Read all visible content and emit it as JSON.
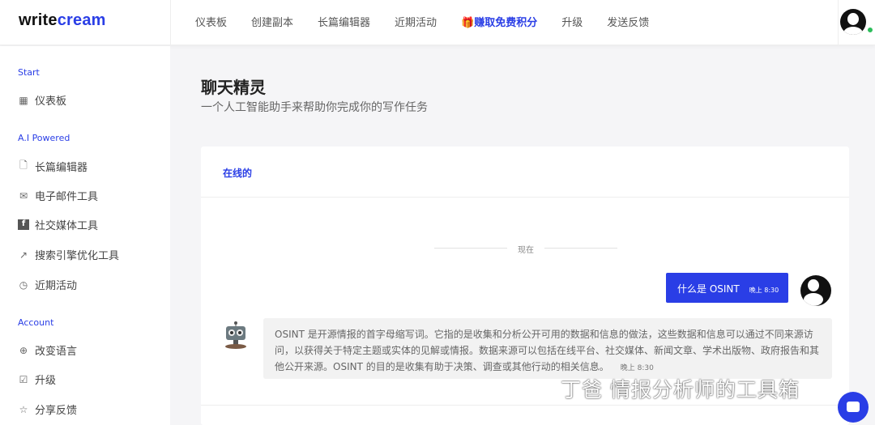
{
  "header": {
    "logo_a": "write",
    "logo_b": "cream",
    "nav": [
      "仪表板",
      "创建副本",
      "长篇编辑器",
      "近期活动",
      "🎁赚取免费积分",
      "升级",
      "发送反馈"
    ]
  },
  "sidebar": {
    "sections": [
      {
        "title": "Start",
        "items": [
          {
            "label": "仪表板",
            "icon": "dashboard-icon"
          }
        ]
      },
      {
        "title": "A.I Powered",
        "items": [
          {
            "label": "长篇编辑器",
            "icon": "document-plus-icon"
          },
          {
            "label": "电子邮件工具",
            "icon": "mail-icon"
          },
          {
            "label": "社交媒体工具",
            "icon": "facebook-icon"
          },
          {
            "label": "搜索引擎优化工具",
            "icon": "trend-icon"
          },
          {
            "label": "近期活动",
            "icon": "clock-icon"
          }
        ]
      },
      {
        "title": "Account",
        "items": [
          {
            "label": "改变语言",
            "icon": "globe-icon"
          },
          {
            "label": "升级",
            "icon": "checkbox-icon"
          },
          {
            "label": "分享反馈",
            "icon": "star-icon"
          }
        ]
      }
    ]
  },
  "main": {
    "title": "聊天精灵",
    "subtitle": "一个人工智能助手来帮助你完成你的写作任务",
    "status": "在线的",
    "divider": "现在",
    "user_msg": {
      "text": "什么是 OSINT",
      "time": "晚上 8:30"
    },
    "bot_msg": {
      "text": "OSINT 是开源情报的首字母缩写词。它指的是收集和分析公开可用的数据和信息的做法，这些数据和信息可以通过不同来源访问，以获得关于特定主题或实体的见解或情报。数据来源可以包括在线平台、社交媒体、新闻文章、学术出版物、政府报告和其他公开来源。OSINT 的目的是收集有助于决策、调查或其他行动的相关信息。",
      "time": "晚上 8:30"
    }
  },
  "watermark": "丁爸 情报分析师的工具箱",
  "colors": {
    "accent": "#2a3ee6"
  }
}
